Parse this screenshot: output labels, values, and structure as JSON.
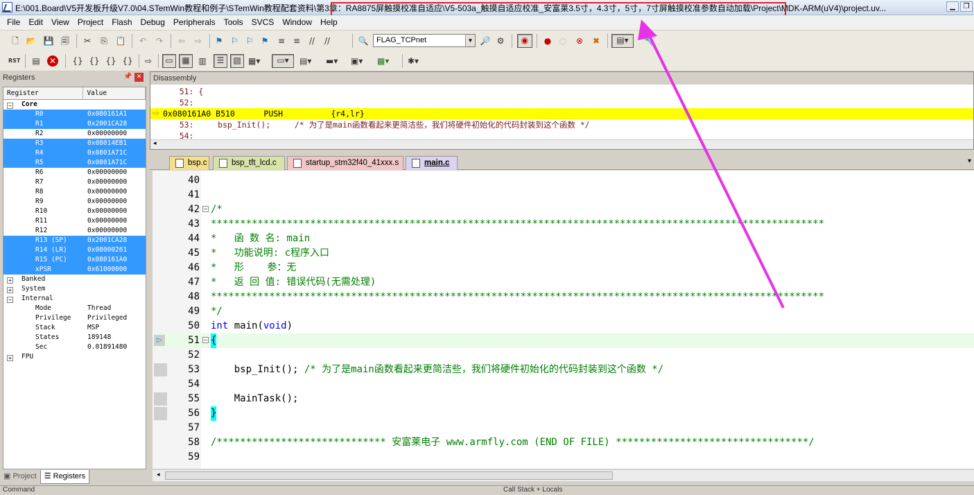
{
  "window": {
    "title": "E:\\001.Board\\V5开发板升级V7.0\\04.STemWin教程和例子\\STemWin教程配套资料\\第3章：RA8875屏触摸校准自适应\\V5-503a_触摸自适应校准_安富莱3.5寸，4.3寸，5寸，7寸屏触摸校准参数自动加载\\Project\\MDK-ARM(uV4)\\project.uv..."
  },
  "menu": [
    "File",
    "Edit",
    "View",
    "Project",
    "Flash",
    "Debug",
    "Peripherals",
    "Tools",
    "SVCS",
    "Window",
    "Help"
  ],
  "toolbar": {
    "target_combo": "FLAG_TCPnet"
  },
  "registers": {
    "title": "Registers",
    "col_register": "Register",
    "col_value": "Value",
    "core_label": "Core",
    "core": [
      {
        "name": "R0",
        "value": "0x080161A1",
        "sel": true
      },
      {
        "name": "R1",
        "value": "0x2001CA28",
        "sel": true
      },
      {
        "name": "R2",
        "value": "0x00000000",
        "sel": false
      },
      {
        "name": "R3",
        "value": "0x08014EB1",
        "sel": true
      },
      {
        "name": "R4",
        "value": "0x0801A71C",
        "sel": true
      },
      {
        "name": "R5",
        "value": "0x0801A71C",
        "sel": true
      },
      {
        "name": "R6",
        "value": "0x00000000",
        "sel": false
      },
      {
        "name": "R7",
        "value": "0x00000000",
        "sel": false
      },
      {
        "name": "R8",
        "value": "0x00000000",
        "sel": false
      },
      {
        "name": "R9",
        "value": "0x00000000",
        "sel": false
      },
      {
        "name": "R10",
        "value": "0x00000000",
        "sel": false
      },
      {
        "name": "R11",
        "value": "0x00000000",
        "sel": false
      },
      {
        "name": "R12",
        "value": "0x00000000",
        "sel": false
      },
      {
        "name": "R13 (SP)",
        "value": "0x2001CA28",
        "sel": true
      },
      {
        "name": "R14 (LR)",
        "value": "0x08000261",
        "sel": true
      },
      {
        "name": "R15 (PC)",
        "value": "0x080161A0",
        "sel": true
      },
      {
        "name": "xPSR",
        "value": "0x61000000",
        "sel": true
      }
    ],
    "groups": [
      "Banked",
      "System",
      "Internal"
    ],
    "internal": [
      {
        "name": "Mode",
        "value": "Thread"
      },
      {
        "name": "Privilege",
        "value": "Privileged"
      },
      {
        "name": "Stack",
        "value": "MSP"
      },
      {
        "name": "States",
        "value": "189148"
      },
      {
        "name": "Sec",
        "value": "0.01891480"
      }
    ],
    "fpu_label": "FPU"
  },
  "bottom_tabs": {
    "project": "Project",
    "registers": "Registers"
  },
  "disassembly": {
    "title": "Disassembly",
    "lines": [
      {
        "text": "    51: {"
      },
      {
        "text": "    52:"
      },
      {
        "text": "0x080161A0 B510      PUSH          {r4,lr}"
      },
      {
        "text": "    53:     bsp_Init();     /* 为了是main函数看起来更简洁些，我们将硬件初始化的代码封装到这个函数 */"
      },
      {
        "text": "    54:"
      }
    ]
  },
  "file_tabs": [
    "bsp.c",
    "bsp_tft_lcd.c",
    "startup_stm32f40_41xxx.s",
    "main.c"
  ],
  "editor": {
    "lines": [
      {
        "n": "40",
        "code": ""
      },
      {
        "n": "41",
        "code": ""
      },
      {
        "n": "42",
        "code": "/*"
      },
      {
        "n": "43",
        "code": "*********************************************************************************************************"
      },
      {
        "n": "44",
        "code": "*   函 数 名: main"
      },
      {
        "n": "45",
        "code": "*   功能说明: c程序入口"
      },
      {
        "n": "46",
        "code": "*   形    参：无"
      },
      {
        "n": "47",
        "code": "*   返 回 值: 错误代码(无需处理)"
      },
      {
        "n": "48",
        "code": "*********************************************************************************************************"
      },
      {
        "n": "49",
        "code": "*/"
      },
      {
        "n": "50",
        "kw1": "int",
        "mid": " main(",
        "kw2": "void",
        "end": ")"
      },
      {
        "n": "51",
        "code": "{"
      },
      {
        "n": "52",
        "code": ""
      },
      {
        "n": "53",
        "pre": "    bsp_Init(); ",
        "comment": "/* 为了是main函数看起来更简洁些，我们将硬件初始化的代码封装到这个函数 */"
      },
      {
        "n": "54",
        "code": ""
      },
      {
        "n": "55",
        "code": "    MainTask();"
      },
      {
        "n": "56",
        "code": "}"
      },
      {
        "n": "57",
        "code": ""
      },
      {
        "n": "58",
        "code": "/***************************** 安富莱电子 www.armfly.com (END OF FILE) *********************************/"
      },
      {
        "n": "59",
        "code": ""
      }
    ]
  },
  "status": {
    "left": "Command",
    "right": "Call Stack + Locals"
  },
  "colors": {
    "selection": "#3399ff",
    "current_line": "#ffff00",
    "comment": "#008000",
    "keyword": "#0000ff",
    "arrow": "#e633e6",
    "highlight_box": "#e02020"
  }
}
